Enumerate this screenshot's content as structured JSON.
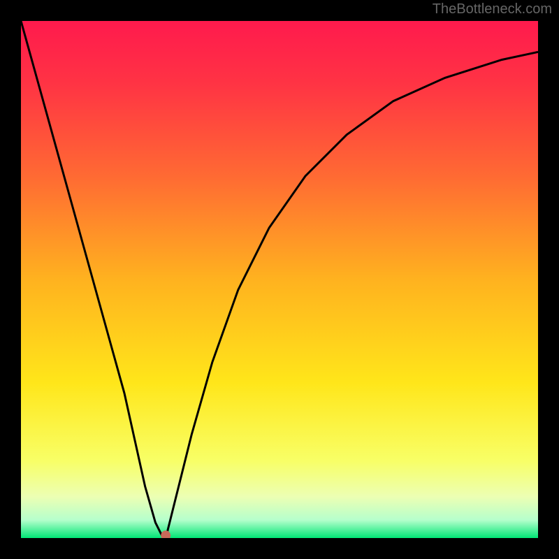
{
  "watermark": "TheBottleneck.com",
  "chart_data": {
    "type": "line",
    "title": "",
    "xlabel": "",
    "ylabel": "",
    "xlim": [
      0,
      100
    ],
    "ylim": [
      0,
      100
    ],
    "series": [
      {
        "name": "curve",
        "x": [
          0,
          5,
          10,
          15,
          20,
          24,
          26,
          27.5,
          28,
          30,
          33,
          37,
          42,
          48,
          55,
          63,
          72,
          82,
          93,
          100
        ],
        "y": [
          100,
          82,
          64,
          46,
          28,
          10,
          3,
          0,
          0,
          8,
          20,
          34,
          48,
          60,
          70,
          78,
          84.5,
          89,
          92.5,
          94
        ]
      }
    ],
    "marker": {
      "x": 28,
      "y": 0.5
    },
    "background_gradient": {
      "stops": [
        {
          "offset": 0.0,
          "color": "#ff1a4d"
        },
        {
          "offset": 0.12,
          "color": "#ff3344"
        },
        {
          "offset": 0.3,
          "color": "#ff6a33"
        },
        {
          "offset": 0.5,
          "color": "#ffb21f"
        },
        {
          "offset": 0.7,
          "color": "#ffe61a"
        },
        {
          "offset": 0.85,
          "color": "#f8ff66"
        },
        {
          "offset": 0.92,
          "color": "#ecffb3"
        },
        {
          "offset": 0.965,
          "color": "#b6ffcc"
        },
        {
          "offset": 1.0,
          "color": "#00e676"
        }
      ]
    }
  }
}
